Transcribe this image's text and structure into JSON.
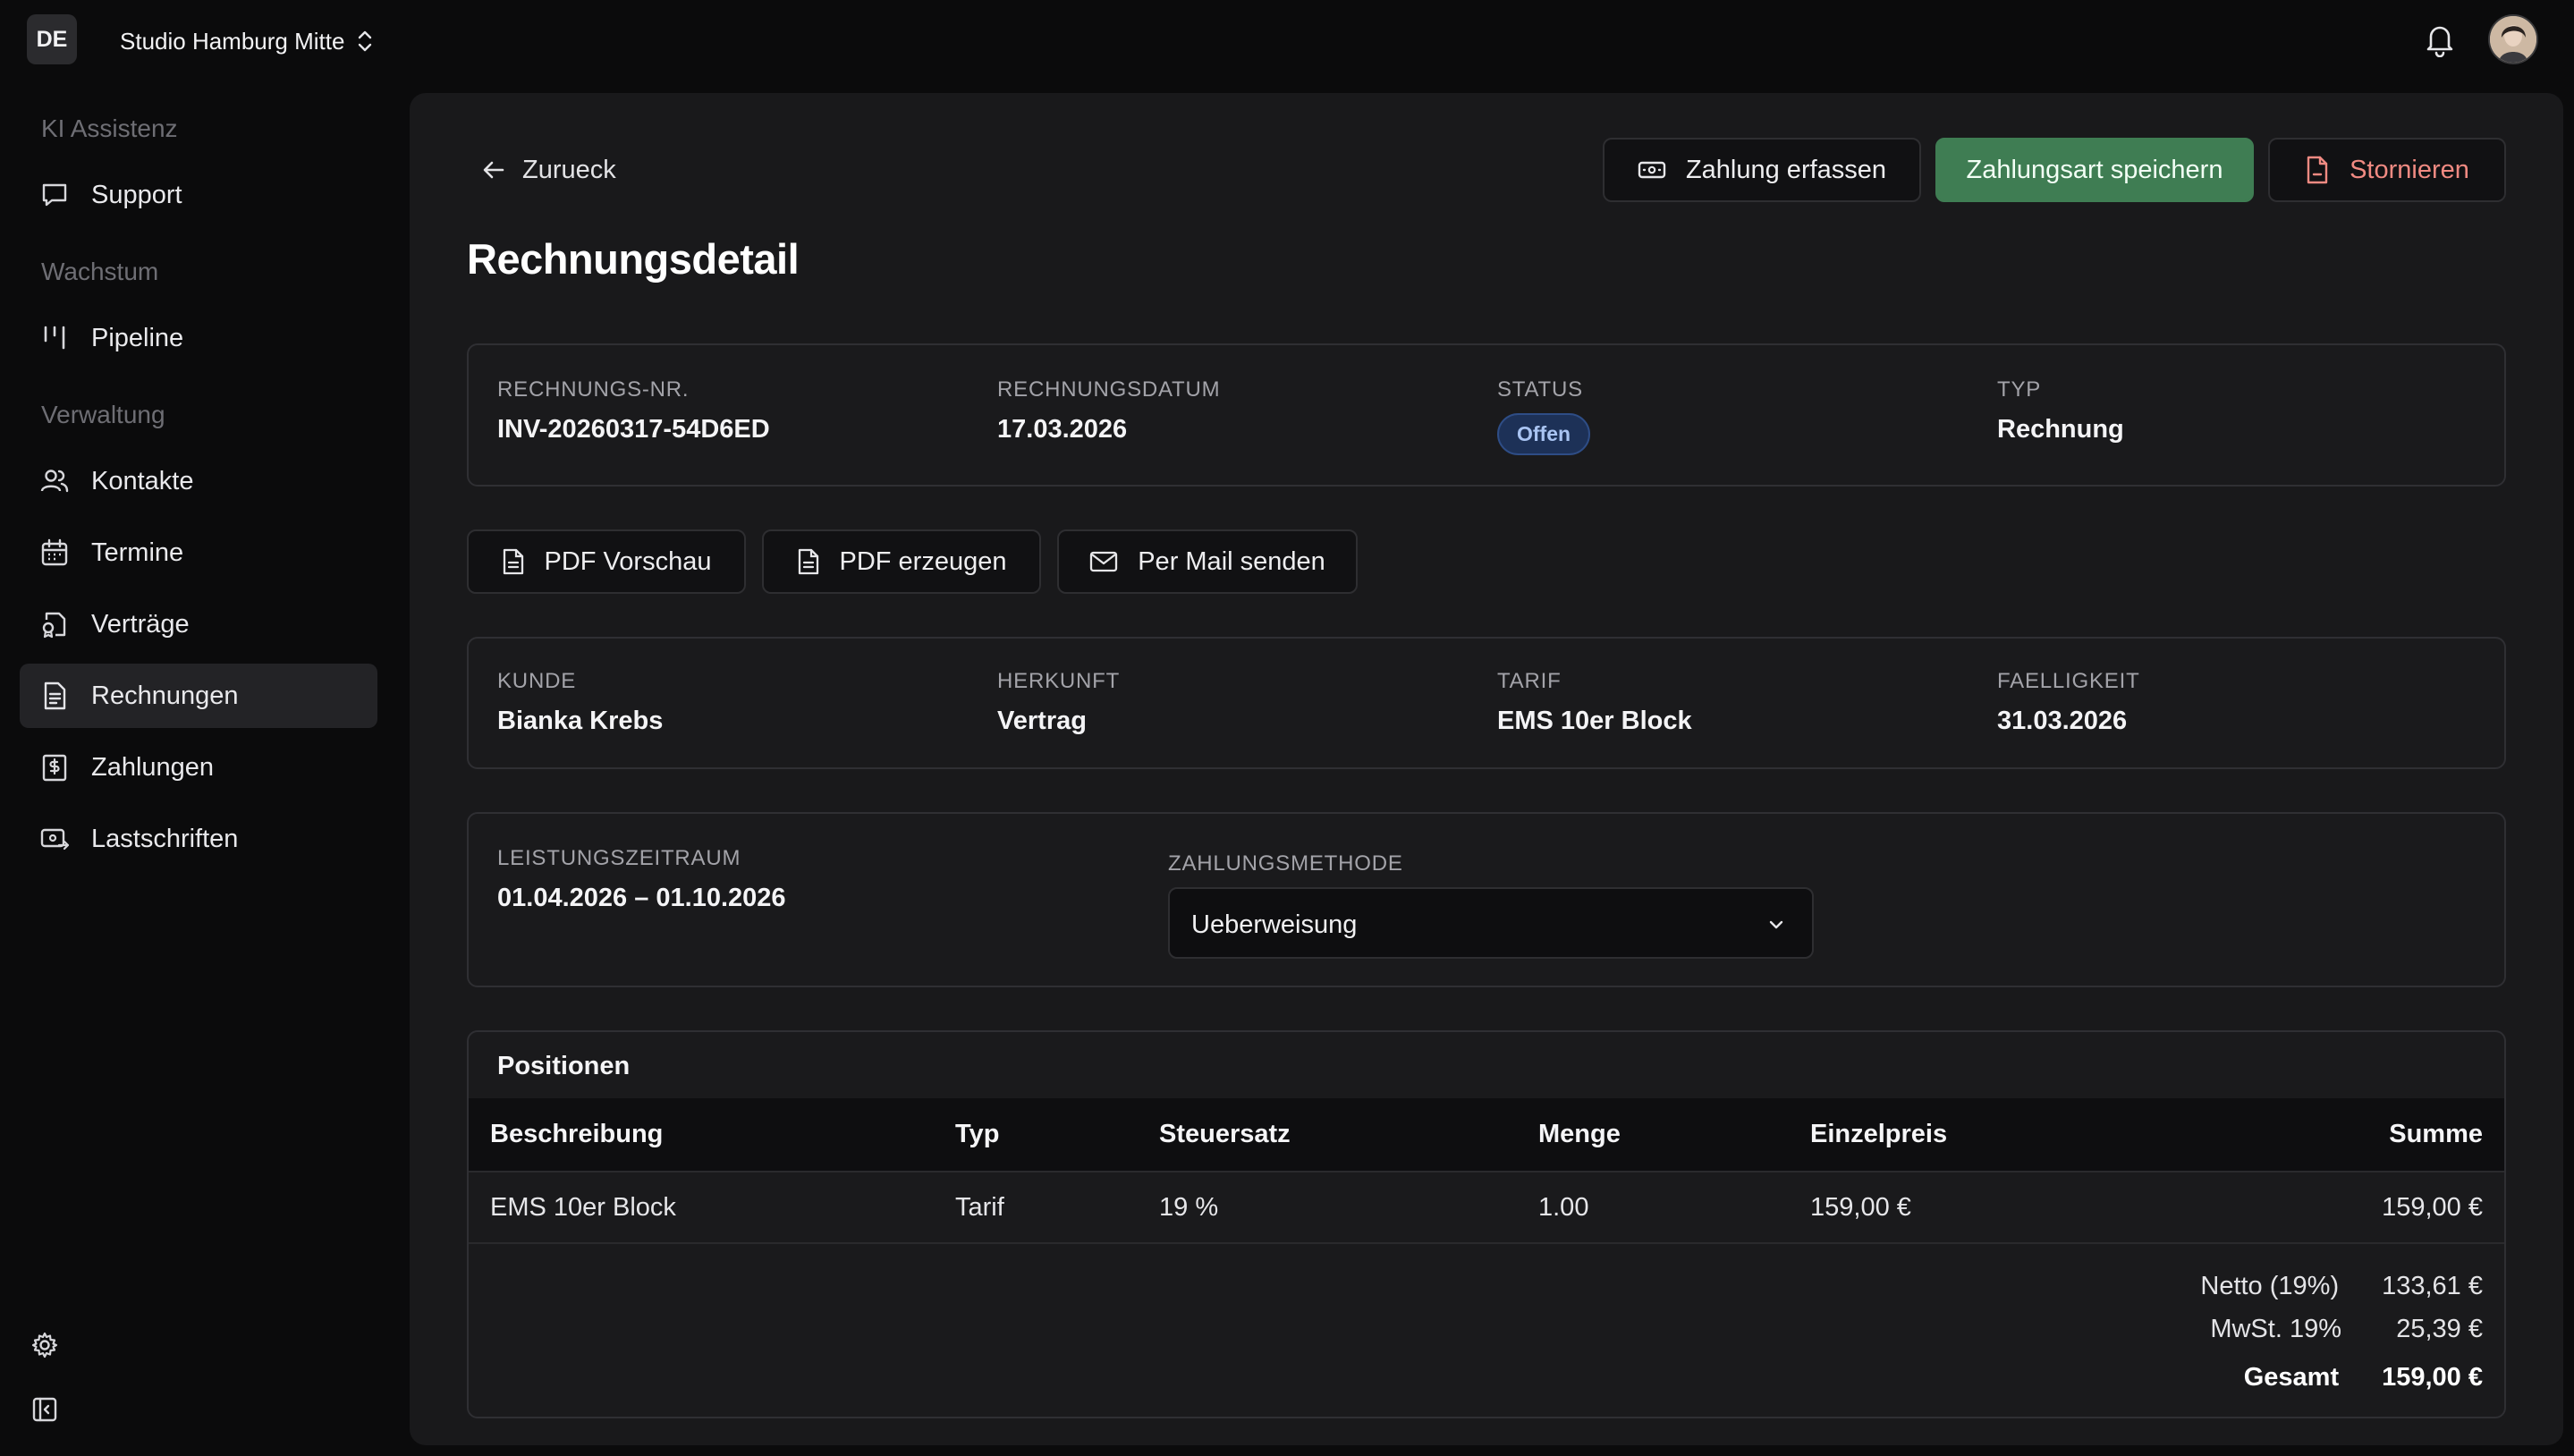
{
  "header": {
    "org_badge": "DE",
    "org_name": "Studio Hamburg Mitte",
    "icons": [
      "chevron-up-down-icon",
      "bell-icon",
      "avatar"
    ]
  },
  "sidebar": {
    "groups": [
      {
        "label": "KI Assistenz",
        "items": [
          {
            "label": "Support",
            "icon": "chat-icon"
          }
        ]
      },
      {
        "label": "Wachstum",
        "items": [
          {
            "label": "Pipeline",
            "icon": "pipeline-icon"
          }
        ]
      },
      {
        "label": "Verwaltung",
        "items": [
          {
            "label": "Kontakte",
            "icon": "users-icon"
          },
          {
            "label": "Termine",
            "icon": "calendar-icon"
          },
          {
            "label": "Verträge",
            "icon": "contract-icon"
          },
          {
            "label": "Rechnungen",
            "icon": "invoice-icon",
            "active": true
          },
          {
            "label": "Zahlungen",
            "icon": "payment-icon"
          },
          {
            "label": "Lastschriften",
            "icon": "direct-debit-icon"
          }
        ]
      }
    ],
    "footer_icons": [
      "gear-icon",
      "sidebar-collapse-icon"
    ]
  },
  "page": {
    "back_label": "Zurueck",
    "title": "Rechnungsdetail",
    "actions": {
      "record_payment": "Zahlung erfassen",
      "save_payment_method": "Zahlungsart speichern",
      "cancel_invoice": "Stornieren"
    }
  },
  "summary": {
    "invoice_no_label": "RECHNUNGS-NR.",
    "invoice_no": "INV-20260317-54D6ED",
    "date_label": "RECHNUNGSDATUM",
    "date": "17.03.2026",
    "status_label": "STATUS",
    "status": "Offen",
    "type_label": "TYP",
    "type": "Rechnung"
  },
  "documents": {
    "pdf_preview": "PDF Vorschau",
    "pdf_generate": "PDF erzeugen",
    "send_mail": "Per Mail senden"
  },
  "details": {
    "customer_label": "KUNDE",
    "customer": "Bianka Krebs",
    "origin_label": "HERKUNFT",
    "origin": "Vertrag",
    "tariff_label": "TARIF",
    "tariff": "EMS 10er Block",
    "due_label": "FAELLIGKEIT",
    "due": "31.03.2026"
  },
  "service": {
    "period_label": "LEISTUNGSZEITRAUM",
    "period": "01.04.2026 – 01.10.2026",
    "method_label": "ZAHLUNGSMETHODE",
    "method": "Ueberweisung"
  },
  "positions": {
    "title": "Positionen",
    "columns": [
      "Beschreibung",
      "Typ",
      "Steuersatz",
      "Menge",
      "Einzelpreis",
      "Summe"
    ],
    "rows": [
      [
        "EMS 10er Block",
        "Tarif",
        "19 %",
        "1.00",
        "159,00 €",
        "159,00 €"
      ]
    ],
    "totals": {
      "net_label": "Netto (19%)",
      "net": "133,61 €",
      "vat_label": "MwSt. 19%",
      "vat": "25,39 €",
      "total_label": "Gesamt",
      "total": "159,00 €"
    }
  },
  "colors": {
    "primary": "#3f7d53",
    "danger": "#f08a82",
    "status_badge": "#1d3157"
  }
}
